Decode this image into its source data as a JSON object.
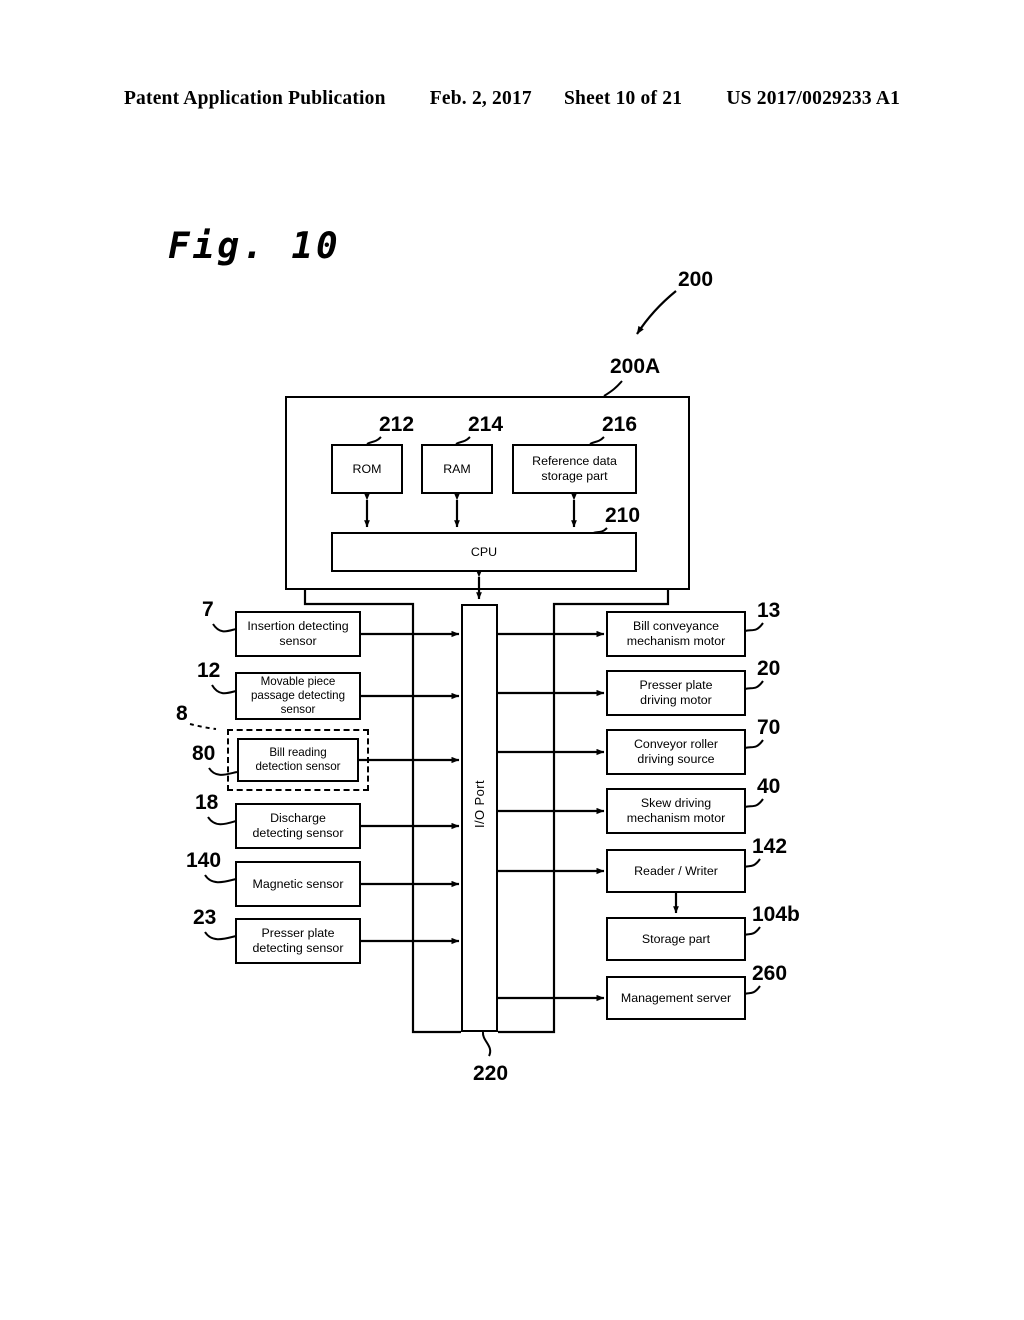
{
  "header": {
    "publication": "Patent Application Publication",
    "date": "Feb. 2, 2017",
    "sheet": "Sheet 10 of 21",
    "number": "US 2017/0029233 A1"
  },
  "figure": {
    "title": "Fig. 10"
  },
  "refs": {
    "system": "200",
    "control_unit": "200A",
    "rom": "212",
    "ram": "214",
    "reference_storage": "216",
    "cpu": "210",
    "io_port": "220",
    "insertion_sensor": "7",
    "movable_piece_sensor": "12",
    "bill_reading_group": "8",
    "bill_reading_sensor": "80",
    "discharge_sensor": "18",
    "magnetic_sensor": "140",
    "presser_plate_sensor": "23",
    "bill_conveyance_motor": "13",
    "presser_plate_motor": "20",
    "conveyor_roller_source": "70",
    "skew_motor": "40",
    "reader_writer": "142",
    "storage_part": "104b",
    "management_server": "260"
  },
  "control_unit": {
    "memories": [
      {
        "label": "ROM"
      },
      {
        "label": "RAM"
      },
      {
        "label": "Reference data\nstorage part"
      }
    ],
    "cpu_label": "CPU"
  },
  "io_port": {
    "label": "I/O Port"
  },
  "inputs": [
    {
      "label": "Insertion detecting\nsensor"
    },
    {
      "label": "Movable piece\npassage detecting\nsensor"
    },
    {
      "label": "Bill reading\ndetection sensor"
    },
    {
      "label": "Discharge\ndetecting sensor"
    },
    {
      "label": "Magnetic sensor"
    },
    {
      "label": "Presser plate\ndetecting sensor"
    }
  ],
  "outputs": [
    {
      "label": "Bill conveyance\nmechanism motor"
    },
    {
      "label": "Presser plate\ndriving motor"
    },
    {
      "label": "Conveyor roller\ndriving source"
    },
    {
      "label": "Skew driving\nmechanism motor"
    },
    {
      "label": "Reader / Writer"
    },
    {
      "label": "Storage part"
    },
    {
      "label": "Management server"
    }
  ],
  "colors": {
    "ink": "#000000",
    "paper": "#ffffff"
  }
}
